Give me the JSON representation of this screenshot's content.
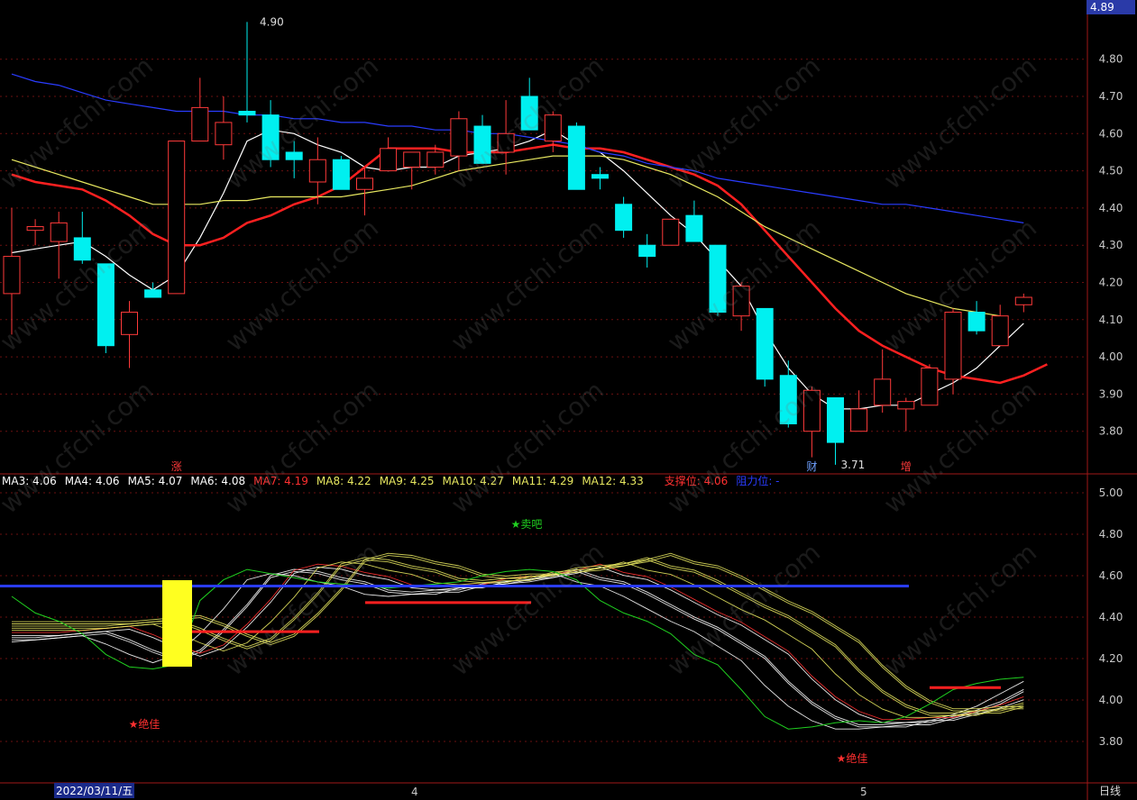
{
  "chart_data": [
    {
      "type": "candlestick",
      "panel": "main",
      "ylim": [
        3.7,
        4.92
      ],
      "yticks": [
        "4.80",
        "4.70",
        "4.60",
        "4.50",
        "4.40",
        "4.30",
        "4.20",
        "4.10",
        "4.00",
        "3.90",
        "3.80"
      ],
      "current_price": "4.89",
      "annotations": {
        "high": "4.90",
        "low": "3.71"
      },
      "event_markers": [
        "涨",
        "财",
        "增"
      ],
      "candles": [
        {
          "o": 4.17,
          "h": 4.4,
          "l": 4.06,
          "c": 4.27
        },
        {
          "o": 4.34,
          "h": 4.37,
          "l": 4.3,
          "c": 4.35
        },
        {
          "o": 4.31,
          "h": 4.39,
          "l": 4.21,
          "c": 4.36
        },
        {
          "o": 4.32,
          "h": 4.39,
          "l": 4.25,
          "c": 4.26
        },
        {
          "o": 4.25,
          "h": 4.25,
          "l": 4.01,
          "c": 4.03
        },
        {
          "o": 4.06,
          "h": 4.15,
          "l": 3.97,
          "c": 4.12
        },
        {
          "o": 4.18,
          "h": 4.2,
          "l": 4.16,
          "c": 4.16
        },
        {
          "o": 4.17,
          "h": 4.58,
          "l": 4.17,
          "c": 4.58
        },
        {
          "o": 4.58,
          "h": 4.75,
          "l": 4.58,
          "c": 4.67
        },
        {
          "o": 4.57,
          "h": 4.7,
          "l": 4.53,
          "c": 4.63
        },
        {
          "o": 4.66,
          "h": 4.9,
          "l": 4.63,
          "c": 4.65
        },
        {
          "o": 4.65,
          "h": 4.69,
          "l": 4.51,
          "c": 4.53
        },
        {
          "o": 4.55,
          "h": 4.58,
          "l": 4.48,
          "c": 4.53
        },
        {
          "o": 4.47,
          "h": 4.59,
          "l": 4.41,
          "c": 4.53
        },
        {
          "o": 4.53,
          "h": 4.54,
          "l": 4.45,
          "c": 4.45
        },
        {
          "o": 4.45,
          "h": 4.51,
          "l": 4.38,
          "c": 4.48
        },
        {
          "o": 4.5,
          "h": 4.59,
          "l": 4.5,
          "c": 4.56
        },
        {
          "o": 4.51,
          "h": 4.55,
          "l": 4.45,
          "c": 4.55
        },
        {
          "o": 4.51,
          "h": 4.57,
          "l": 4.49,
          "c": 4.55
        },
        {
          "o": 4.54,
          "h": 4.66,
          "l": 4.5,
          "c": 4.64
        },
        {
          "o": 4.62,
          "h": 4.65,
          "l": 4.52,
          "c": 4.52
        },
        {
          "o": 4.55,
          "h": 4.69,
          "l": 4.49,
          "c": 4.6
        },
        {
          "o": 4.7,
          "h": 4.75,
          "l": 4.62,
          "c": 4.61
        },
        {
          "o": 4.58,
          "h": 4.66,
          "l": 4.55,
          "c": 4.65
        },
        {
          "o": 4.62,
          "h": 4.63,
          "l": 4.45,
          "c": 4.45
        },
        {
          "o": 4.49,
          "h": 4.51,
          "l": 4.45,
          "c": 4.48
        },
        {
          "o": 4.41,
          "h": 4.43,
          "l": 4.32,
          "c": 4.34
        },
        {
          "o": 4.3,
          "h": 4.33,
          "l": 4.24,
          "c": 4.27
        },
        {
          "o": 4.3,
          "h": 4.37,
          "l": 4.3,
          "c": 4.37
        },
        {
          "o": 4.38,
          "h": 4.42,
          "l": 4.31,
          "c": 4.31
        },
        {
          "o": 4.3,
          "h": 4.3,
          "l": 4.11,
          "c": 4.12
        },
        {
          "o": 4.11,
          "h": 4.2,
          "l": 4.07,
          "c": 4.19
        },
        {
          "o": 4.13,
          "h": 4.13,
          "l": 3.92,
          "c": 3.94
        },
        {
          "o": 3.95,
          "h": 3.99,
          "l": 3.81,
          "c": 3.82
        },
        {
          "o": 3.8,
          "h": 3.92,
          "l": 3.73,
          "c": 3.91
        },
        {
          "o": 3.89,
          "h": 3.89,
          "l": 3.71,
          "c": 3.77
        },
        {
          "o": 3.8,
          "h": 3.91,
          "l": 3.8,
          "c": 3.86
        },
        {
          "o": 3.87,
          "h": 4.02,
          "l": 3.85,
          "c": 3.94
        },
        {
          "o": 3.86,
          "h": 3.89,
          "l": 3.8,
          "c": 3.88
        },
        {
          "o": 3.87,
          "h": 3.98,
          "l": 3.87,
          "c": 3.97
        },
        {
          "o": 3.94,
          "h": 4.13,
          "l": 3.9,
          "c": 4.12
        },
        {
          "o": 4.12,
          "h": 4.15,
          "l": 4.06,
          "c": 4.07
        },
        {
          "o": 4.03,
          "h": 4.14,
          "l": 4.03,
          "c": 4.11
        },
        {
          "o": 4.14,
          "h": 4.17,
          "l": 4.12,
          "c": 4.16
        }
      ],
      "series": [
        {
          "name": "MA5",
          "color": "#ffffff",
          "values": [
            4.28,
            4.29,
            4.3,
            4.31,
            4.27,
            4.22,
            4.18,
            4.22,
            4.32,
            4.44,
            4.58,
            4.61,
            4.6,
            4.57,
            4.55,
            4.51,
            4.5,
            4.51,
            4.51,
            4.54,
            4.55,
            4.56,
            4.58,
            4.61,
            4.57,
            4.55,
            4.5,
            4.44,
            4.38,
            4.33,
            4.26,
            4.19,
            4.07,
            3.97,
            3.9,
            3.86,
            3.86,
            3.87,
            3.87,
            3.9,
            3.93,
            3.97,
            4.03,
            4.09
          ]
        },
        {
          "name": "MA10",
          "color": "#ff2020",
          "values": [
            4.49,
            4.47,
            4.46,
            4.45,
            4.42,
            4.38,
            4.33,
            4.3,
            4.3,
            4.32,
            4.36,
            4.38,
            4.41,
            4.43,
            4.46,
            4.51,
            4.56,
            4.56,
            4.56,
            4.55,
            4.55,
            4.55,
            4.56,
            4.57,
            4.56,
            4.56,
            4.55,
            4.53,
            4.51,
            4.49,
            4.46,
            4.41,
            4.34,
            4.27,
            4.2,
            4.13,
            4.07,
            4.03,
            4.0,
            3.97,
            3.95,
            3.94,
            3.93,
            3.95,
            3.98
          ]
        },
        {
          "name": "MA20",
          "color": "#e8e860",
          "values": [
            4.53,
            4.51,
            4.49,
            4.47,
            4.45,
            4.43,
            4.41,
            4.41,
            4.41,
            4.42,
            4.42,
            4.43,
            4.43,
            4.43,
            4.43,
            4.44,
            4.45,
            4.46,
            4.48,
            4.5,
            4.51,
            4.52,
            4.53,
            4.54,
            4.54,
            4.54,
            4.53,
            4.51,
            4.49,
            4.46,
            4.43,
            4.39,
            4.35,
            4.32,
            4.29,
            4.26,
            4.23,
            4.2,
            4.17,
            4.15,
            4.13,
            4.12,
            4.11
          ]
        },
        {
          "name": "MA60",
          "color": "#2a3cff",
          "values": [
            4.76,
            4.74,
            4.73,
            4.71,
            4.69,
            4.68,
            4.67,
            4.66,
            4.66,
            4.66,
            4.65,
            4.65,
            4.64,
            4.64,
            4.63,
            4.63,
            4.62,
            4.62,
            4.61,
            4.61,
            4.6,
            4.6,
            4.59,
            4.58,
            4.57,
            4.55,
            4.54,
            4.52,
            4.51,
            4.5,
            4.48,
            4.47,
            4.46,
            4.45,
            4.44,
            4.43,
            4.42,
            4.41,
            4.41,
            4.4,
            4.39,
            4.38,
            4.37,
            4.36
          ]
        }
      ]
    },
    {
      "type": "line",
      "panel": "indicator",
      "ylim": [
        3.7,
        5.05
      ],
      "yticks": [
        "5.00",
        "4.80",
        "4.60",
        "4.40",
        "4.20",
        "4.00",
        "3.80"
      ],
      "labels": [
        {
          "text": "MA3: 4.06",
          "color": "#ffffff"
        },
        {
          "text": "MA4: 4.06",
          "color": "#ffffff"
        },
        {
          "text": "MA5: 4.07",
          "color": "#ffffff"
        },
        {
          "text": "MA6: 4.08",
          "color": "#ffffff"
        },
        {
          "text": "MA7: 4.19",
          "color": "#ff3030"
        },
        {
          "text": "MA8: 4.22",
          "color": "#e8e860"
        },
        {
          "text": "MA9: 4.25",
          "color": "#e8e860"
        },
        {
          "text": "MA10: 4.27",
          "color": "#e8e860"
        },
        {
          "text": "MA11: 4.29",
          "color": "#e8e860"
        },
        {
          "text": "MA12: 4.33",
          "color": "#e8e860"
        },
        {
          "text": "支撑位: 4.06",
          "color": "#ff3030"
        },
        {
          "text": "阻力位: -",
          "color": "#2a3cff"
        }
      ],
      "signals": [
        "★卖吧",
        "★绝佳",
        "★绝佳"
      ],
      "support_lines": [
        4.33,
        4.47,
        4.06
      ],
      "resistance_line": 4.55,
      "green_line": [
        4.5,
        4.42,
        4.38,
        4.32,
        4.22,
        4.16,
        4.15,
        4.17,
        4.48,
        4.58,
        4.63,
        4.61,
        4.59,
        4.57,
        4.56,
        4.55,
        4.54,
        4.55,
        4.56,
        4.57,
        4.6,
        4.62,
        4.63,
        4.62,
        4.58,
        4.48,
        4.42,
        4.38,
        4.32,
        4.22,
        4.17,
        4.05,
        3.92,
        3.86,
        3.87,
        3.89,
        3.9,
        3.89,
        3.92,
        3.98,
        4.05,
        4.08,
        4.1,
        4.11
      ]
    }
  ],
  "x_axis": {
    "date_label": "2022/03/11/五",
    "month_labels": [
      "4",
      "5"
    ],
    "period": "日线"
  }
}
